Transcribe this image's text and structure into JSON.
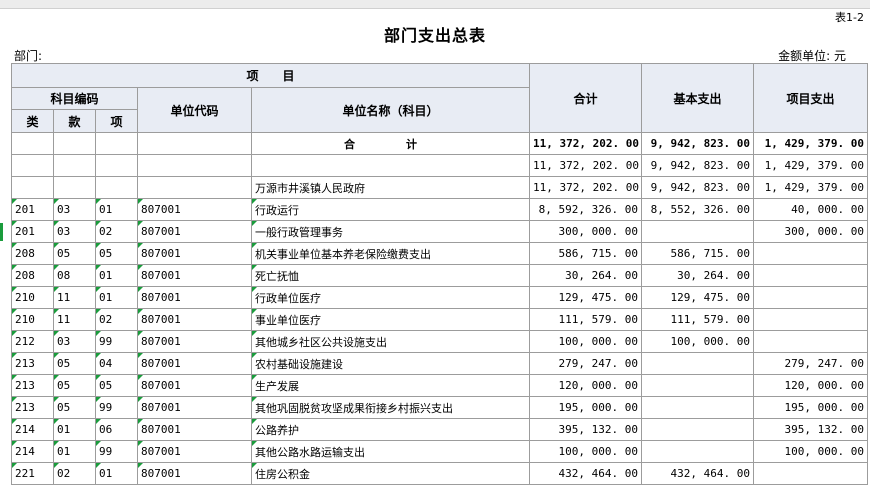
{
  "header": {
    "table_no": "表1-2",
    "title": "部门支出总表",
    "dept_label": "部门:",
    "unit_label": "金额单位: 元"
  },
  "columns": {
    "item": "项　　目",
    "subject_code": "科目编码",
    "lei": "类",
    "kuan": "款",
    "xiang": "项",
    "unit_code": "单位代码",
    "unit_name": "单位名称（科目）",
    "total": "合计",
    "basic": "基本支出",
    "project": "项目支出"
  },
  "total_row": {
    "label": "合　计",
    "total": "11, 372, 202. 00",
    "basic": "9, 942, 823. 00",
    "project": "1, 429, 379. 00"
  },
  "rows": [
    {
      "lei": "",
      "kuan": "",
      "xiang": "",
      "unit_code": "",
      "name": "",
      "total": "11, 372, 202. 00",
      "basic": "9, 942, 823. 00",
      "project": "1, 429, 379. 00"
    },
    {
      "lei": "",
      "kuan": "",
      "xiang": "",
      "unit_code": "",
      "name": "万源市井溪镇人民政府",
      "total": "11, 372, 202. 00",
      "basic": "9, 942, 823. 00",
      "project": "1, 429, 379. 00"
    },
    {
      "lei": "201",
      "kuan": "03",
      "xiang": "01",
      "unit_code": "807001",
      "name": " 行政运行",
      "total": "8, 592, 326. 00",
      "basic": "8, 552, 326. 00",
      "project": "40, 000. 00"
    },
    {
      "lei": "201",
      "kuan": "03",
      "xiang": "02",
      "unit_code": "807001",
      "name": " 一般行政管理事务",
      "total": "300, 000. 00",
      "basic": "",
      "project": "300, 000. 00"
    },
    {
      "lei": "208",
      "kuan": "05",
      "xiang": "05",
      "unit_code": "807001",
      "name": " 机关事业单位基本养老保险缴费支出",
      "total": "586, 715. 00",
      "basic": "586, 715. 00",
      "project": ""
    },
    {
      "lei": "208",
      "kuan": "08",
      "xiang": "01",
      "unit_code": "807001",
      "name": " 死亡抚恤",
      "total": "30, 264. 00",
      "basic": "30, 264. 00",
      "project": ""
    },
    {
      "lei": "210",
      "kuan": "11",
      "xiang": "01",
      "unit_code": "807001",
      "name": " 行政单位医疗",
      "total": "129, 475. 00",
      "basic": "129, 475. 00",
      "project": ""
    },
    {
      "lei": "210",
      "kuan": "11",
      "xiang": "02",
      "unit_code": "807001",
      "name": " 事业单位医疗",
      "total": "111, 579. 00",
      "basic": "111, 579. 00",
      "project": ""
    },
    {
      "lei": "212",
      "kuan": "03",
      "xiang": "99",
      "unit_code": "807001",
      "name": " 其他城乡社区公共设施支出",
      "total": "100, 000. 00",
      "basic": "100, 000. 00",
      "project": ""
    },
    {
      "lei": "213",
      "kuan": "05",
      "xiang": "04",
      "unit_code": "807001",
      "name": " 农村基础设施建设",
      "total": "279, 247. 00",
      "basic": "",
      "project": "279, 247. 00"
    },
    {
      "lei": "213",
      "kuan": "05",
      "xiang": "05",
      "unit_code": "807001",
      "name": " 生产发展",
      "total": "120, 000. 00",
      "basic": "",
      "project": "120, 000. 00"
    },
    {
      "lei": "213",
      "kuan": "05",
      "xiang": "99",
      "unit_code": "807001",
      "name": " 其他巩固脱贫攻坚成果衔接乡村振兴支出",
      "total": "195, 000. 00",
      "basic": "",
      "project": "195, 000. 00"
    },
    {
      "lei": "214",
      "kuan": "01",
      "xiang": "06",
      "unit_code": "807001",
      "name": " 公路养护",
      "total": "395, 132. 00",
      "basic": "",
      "project": "395, 132. 00"
    },
    {
      "lei": "214",
      "kuan": "01",
      "xiang": "99",
      "unit_code": "807001",
      "name": " 其他公路水路运输支出",
      "total": "100, 000. 00",
      "basic": "",
      "project": "100, 000. 00"
    },
    {
      "lei": "221",
      "kuan": "02",
      "xiang": "01",
      "unit_code": "807001",
      "name": " 住房公积金",
      "total": "432, 464. 00",
      "basic": "432, 464. 00",
      "project": ""
    }
  ],
  "colors": {
    "header_bg": "#e8ecf4",
    "grid": "#9c9c9c",
    "marker": "#1a9c3c"
  }
}
